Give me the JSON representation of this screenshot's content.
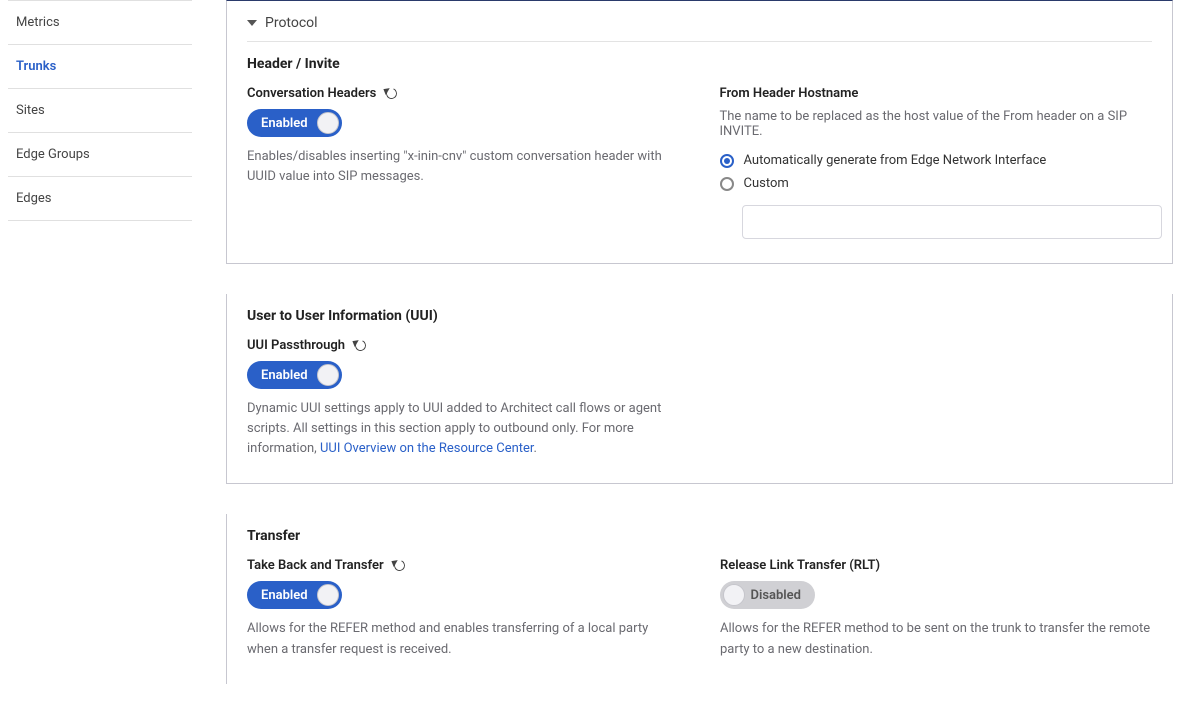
{
  "sidebar": {
    "items": [
      {
        "label": "Metrics"
      },
      {
        "label": "Trunks"
      },
      {
        "label": "Sites"
      },
      {
        "label": "Edge Groups"
      },
      {
        "label": "Edges"
      }
    ]
  },
  "protocol": {
    "title": "Protocol"
  },
  "headerInvite": {
    "heading": "Header / Invite",
    "conversationHeaders": {
      "label": "Conversation Headers",
      "state": "Enabled",
      "help": "Enables/disables inserting \"x-inin-cnv\" custom conversation header with UUID value into SIP messages."
    },
    "fromHeader": {
      "label": "From Header Hostname",
      "sub": "The name to be replaced as the host value of the From header on a SIP INVITE.",
      "opt1": "Automatically generate from Edge Network Interface",
      "opt2": "Custom",
      "customValue": ""
    }
  },
  "uui": {
    "heading": "User to User Information (UUI)",
    "passthrough": {
      "label": "UUI Passthrough",
      "state": "Enabled",
      "helpPre": "Dynamic UUI settings apply to UUI added to Architect call flows or agent scripts. All settings in this section apply to outbound only. For more information, ",
      "linkText": "UUI Overview on the Resource Center",
      "helpPost": "."
    }
  },
  "transfer": {
    "heading": "Transfer",
    "takeBack": {
      "label": "Take Back and Transfer",
      "state": "Enabled",
      "help": "Allows for the REFER method and enables transferring of a local party when a transfer request is received."
    },
    "rlt": {
      "label": "Release Link Transfer (RLT)",
      "state": "Disabled",
      "help": "Allows for the REFER method to be sent on the trunk to transfer the remote party to a new destination."
    }
  }
}
